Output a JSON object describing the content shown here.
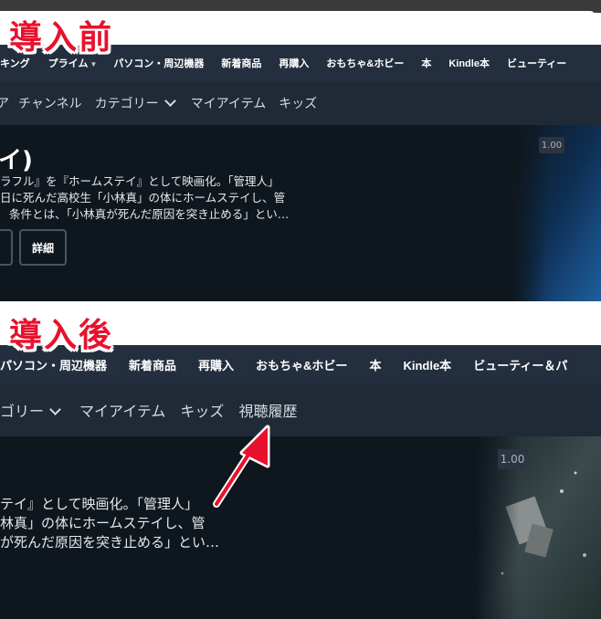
{
  "labels": {
    "before": "導入前",
    "after": "導入後"
  },
  "before": {
    "amazon_nav": [
      "キング",
      "プライム",
      "パソコン・周辺機器",
      "新着商品",
      "再購入",
      "おもちゃ&ホビー",
      "本",
      "Kindle本",
      "ビューティー"
    ],
    "video_nav": [
      "ア",
      "チャンネル",
      "カテゴリー",
      "マイアイテム",
      "キッズ"
    ],
    "hero": {
      "title": "イ)",
      "lines": [
        "ラフル』を『ホームステイ』として映画化。「管理人」",
        "日に死んだ高校生「小林真」の体にホームステイし、管",
        "条件とは、「小林真が死んだ原因を突き止める」とい…"
      ],
      "details_button": "詳細",
      "rating": "1.00"
    }
  },
  "after": {
    "amazon_nav": [
      "パソコン・周辺機器",
      "新着商品",
      "再購入",
      "おもちゃ&ホビー",
      "本",
      "Kindle本",
      "ビューティー＆パ"
    ],
    "video_nav": [
      "ゴリー",
      "マイアイテム",
      "キッズ",
      "視聴履歴"
    ],
    "hero": {
      "lines": [
        "テイ』として映画化。「管理人」",
        "林真」の体にホームステイし、管",
        "が死んだ原因を突き止める」とい…"
      ],
      "rating": "1.00"
    }
  },
  "colors": {
    "accent_red": "#e8112d",
    "amazon_nav_bg": "#232f3e",
    "video_nav_bg": "#1f2a36",
    "hero_bg": "#0f171e"
  }
}
